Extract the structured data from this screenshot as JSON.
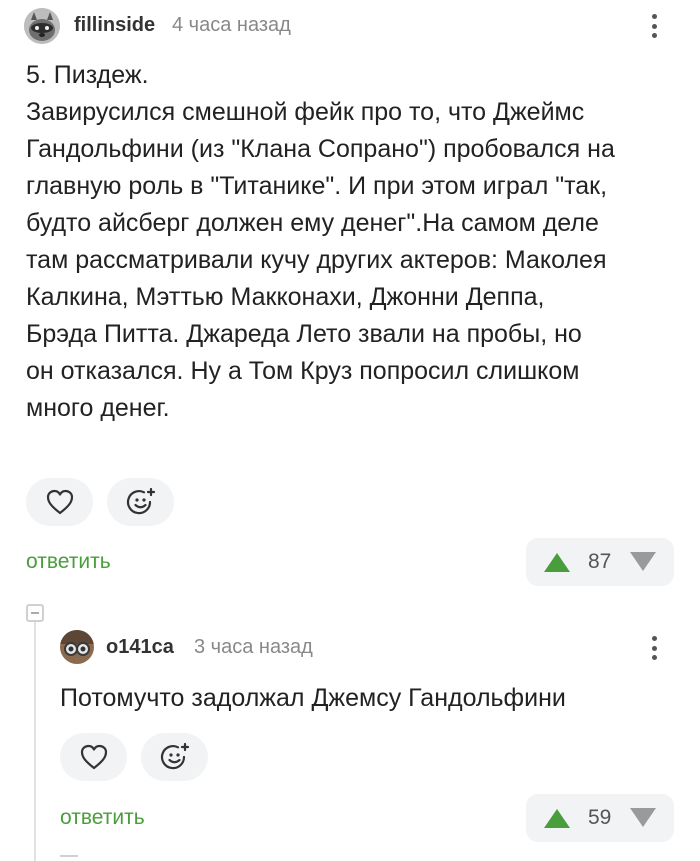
{
  "comment": {
    "username": "fillinside",
    "timestamp": "4 часа назад",
    "text": "5. Пиздеж.\nЗавирусился смешной фейк про то, что Джеймс\nГандольфини (из \"Клана Сопрано\") пробовался на\nглавную роль в \"Титанике\". И при этом играл \"так,\nбудто айсберг должен ему денег\".На самом деле\nтам рассматривали кучу других актеров: Маколея\nКалкина, Мэттью Макконахи, Джонни Деппа,\nБрэда Питта. Джареда Лето звали на пробы, но\nон отказался. Ну а Том Круз попросил слишком\nмного денег.",
    "reply_label": "ответить",
    "rating": "87",
    "avatar_icon": "raccoon-avatar"
  },
  "reply": {
    "username": "o141ca",
    "timestamp": "3 часа назад",
    "text": "Потомучто задолжал Джемсу Гандольфини",
    "reply_label": "ответить",
    "rating": "59",
    "avatar_icon": "binoculars-avatar"
  },
  "colors": {
    "accent_green": "#4a9d3c",
    "downvote_gray": "#9a9a9a",
    "pill_bg": "#f2f3f5"
  }
}
